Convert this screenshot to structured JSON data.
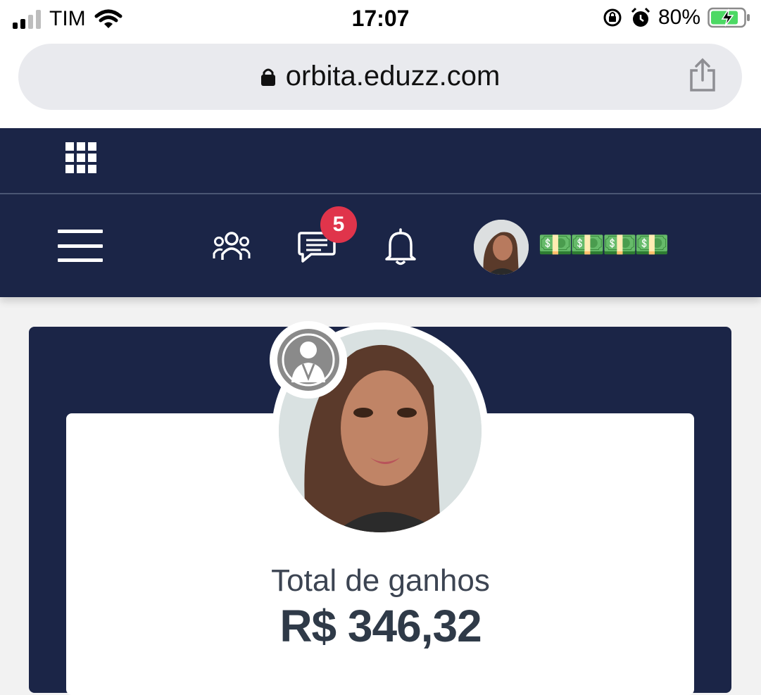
{
  "status_bar": {
    "carrier": "TIM",
    "time": "17:07",
    "battery_percent": "80%",
    "signal_bars_active": 2,
    "signal_bars_total": 4
  },
  "browser": {
    "url": "orbita.eduzz.com",
    "lock_icon": "lock-icon",
    "share_icon": "share-icon"
  },
  "top_nav": {
    "apps_icon": "grid-icon"
  },
  "main_nav": {
    "menu_icon": "hamburger-icon",
    "community_icon": "users-icon",
    "messages_icon": "chat-icon",
    "messages_badge": "5",
    "notifications_icon": "bell-icon",
    "user_status_emoji": "💵💵💵💵"
  },
  "profile_card": {
    "level_icon": "user-badge-icon",
    "earnings_label": "Total de ganhos",
    "earnings_value": "R$ 346,32"
  },
  "colors": {
    "nav_bg": "#1b2547",
    "badge_red": "#e0344b",
    "text_dark": "#2f3a48"
  }
}
